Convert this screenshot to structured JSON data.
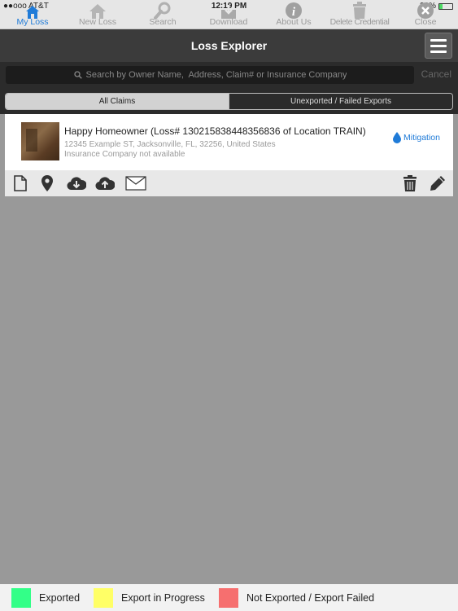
{
  "status_bar": {
    "carrier": "●●ooo AT&T",
    "time": "12:19 PM",
    "battery": "22%"
  },
  "tabs": [
    {
      "label": "My Loss",
      "icon": "home-icon",
      "active": true
    },
    {
      "label": "New Loss",
      "icon": "new-house-icon",
      "active": false
    },
    {
      "label": "Search",
      "icon": "search-icon",
      "active": false
    },
    {
      "label": "Download",
      "icon": "download-tray-icon",
      "active": false
    },
    {
      "label": "About Us",
      "icon": "info-icon",
      "active": false
    },
    {
      "label": "Delete Credential",
      "icon": "trash-icon",
      "active": false
    },
    {
      "label": "Close",
      "icon": "close-icon",
      "active": false
    }
  ],
  "nav": {
    "title": "Loss Explorer",
    "menu_icon": "hamburger-menu-icon"
  },
  "search": {
    "placeholder": "Search by Owner Name,  Address, Claim# or Insurance Company",
    "cancel_label": "Cancel"
  },
  "segments": [
    {
      "label": "All Claims",
      "selected": true
    },
    {
      "label": "Unexported / Failed Exports",
      "selected": false
    }
  ],
  "claim": {
    "title": "Happy Homeowner (Loss# 130215838448356836 of Location TRAIN)",
    "address": "12345 Example ST, Jacksonville, FL, 32256, United States",
    "insurance": "Insurance Company not available",
    "mitigation_label": "Mitigation"
  },
  "actions": [
    "document-icon",
    "location-pin-icon",
    "cloud-download-icon",
    "cloud-upload-icon",
    "envelope-icon",
    "trash-icon",
    "edit-pencil-icon"
  ],
  "legend": [
    {
      "label": "Exported",
      "color": "#33ff88"
    },
    {
      "label": "Export in Progress",
      "color": "#ffff66"
    },
    {
      "label": "Not Exported / Export Failed",
      "color": "#f66f6f"
    }
  ],
  "colors": {
    "accent": "#1f7bd8",
    "navbar": "#3b3b3b",
    "background": "#999999"
  }
}
